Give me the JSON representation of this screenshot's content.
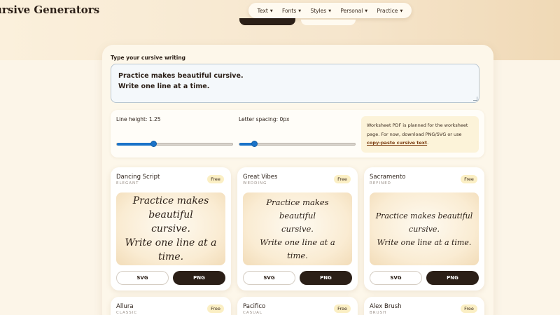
{
  "header": {
    "site_title": "ursive Generators",
    "nav": [
      {
        "label": "Text"
      },
      {
        "label": "Fonts"
      },
      {
        "label": "Styles"
      },
      {
        "label": "Personal"
      },
      {
        "label": "Practice"
      }
    ]
  },
  "editor": {
    "label": "Type your cursive writing",
    "line1": "Practice makes beautiful cursive.",
    "line2": "Write one line at a time."
  },
  "controls": {
    "line_height_label": "Line height: 1.25",
    "line_height_fraction": 0.32,
    "letter_spacing_label": "Letter spacing: 0px",
    "letter_spacing_fraction": 0.13,
    "accent_color": "#1a73c9"
  },
  "note": {
    "text": "Worksheet PDF is planned for the worksheet page. For now, download PNG/SVG or use ",
    "link": "copy-paste cursive text",
    "end": "."
  },
  "preview": {
    "line1": "Practice makes beautiful",
    "line2": "cursive.",
    "line3": "Write one line at a time."
  },
  "cards": [
    {
      "name": "Dancing Script",
      "style": "ELEGANT",
      "badge": "Free",
      "svg_label": "SVG",
      "png_label": "PNG"
    },
    {
      "name": "Great Vibes",
      "style": "WEDDING",
      "badge": "Free",
      "svg_label": "SVG",
      "png_label": "PNG"
    },
    {
      "name": "Sacramento",
      "style": "REFINED",
      "badge": "Free",
      "svg_label": "SVG",
      "png_label": "PNG"
    },
    {
      "name": "Allura",
      "style": "CLASSIC",
      "badge": "Free"
    },
    {
      "name": "Pacifico",
      "style": "CASUAL",
      "badge": "Free"
    },
    {
      "name": "Alex Brush",
      "style": "BRUSH",
      "badge": "Free"
    }
  ],
  "colors": {
    "dark": "#2b1f17",
    "badge": "#fbefc4",
    "link": "#7a3d12"
  }
}
